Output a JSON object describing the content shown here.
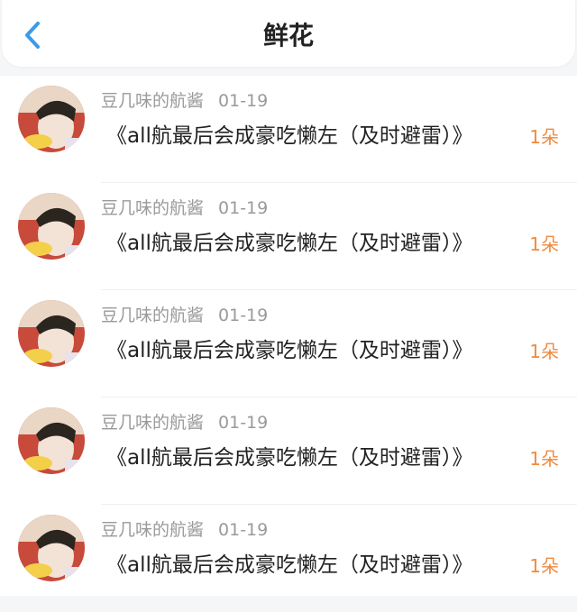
{
  "header": {
    "title": "鲜花",
    "back_icon": "chevron-left-icon",
    "accent_color": "#3b9be8"
  },
  "items": [
    {
      "user": "豆几味的航酱",
      "date": "01-19",
      "book": "《all航最后会成豪吃懒左（及时避雷）》",
      "count": "1朵"
    },
    {
      "user": "豆几味的航酱",
      "date": "01-19",
      "book": "《all航最后会成豪吃懒左（及时避雷）》",
      "count": "1朵"
    },
    {
      "user": "豆几味的航酱",
      "date": "01-19",
      "book": "《all航最后会成豪吃懒左（及时避雷）》",
      "count": "1朵"
    },
    {
      "user": "豆几味的航酱",
      "date": "01-19",
      "book": "《all航最后会成豪吃懒左（及时避雷）》",
      "count": "1朵"
    },
    {
      "user": "豆几味的航酱",
      "date": "01-19",
      "book": "《all航最后会成豪吃懒左（及时避雷）》",
      "count": "1朵"
    }
  ],
  "colors": {
    "count": "#f08a3e",
    "meta": "#9a9a9a",
    "text": "#222222"
  }
}
